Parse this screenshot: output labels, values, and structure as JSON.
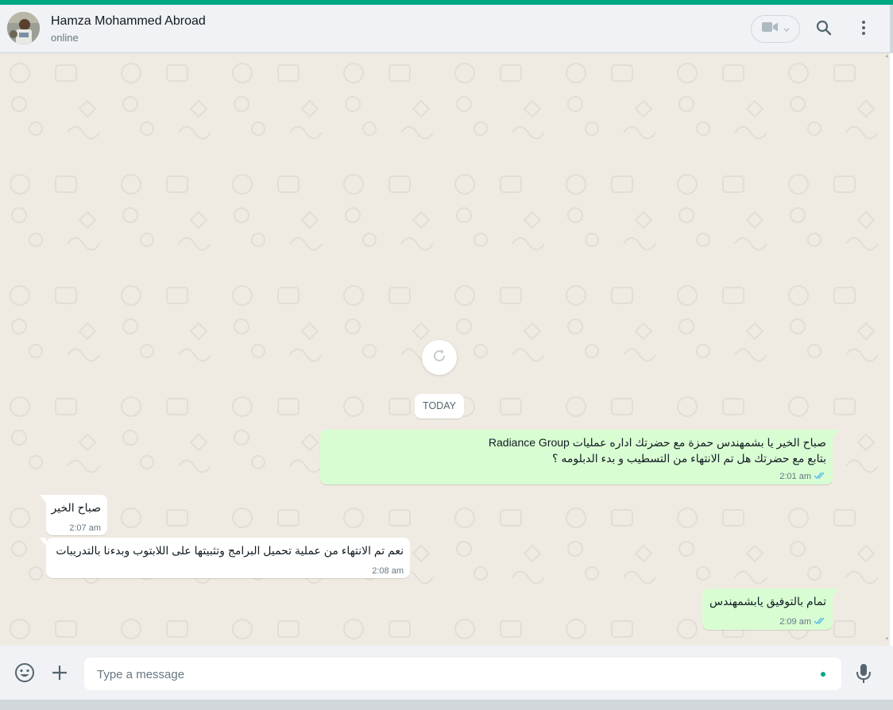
{
  "header": {
    "contact_name": "Hamza Mohammed Abroad",
    "status": "online",
    "avatar_icon": "contact-avatar",
    "video_icon": "video-camera-icon",
    "search_icon": "search-icon",
    "menu_icon": "kebab-menu-icon"
  },
  "chat": {
    "date_chip": "TODAY",
    "refresh_icon": "refresh-icon",
    "messages": [
      {
        "direction": "out",
        "lines": [
          "صباح الخير يا بشمهندس حمزة مع  حضرتك اداره عمليات Radiance Group",
          "بتابع مع حضرتك هل تم الانتهاء من التسطيب و بدء الدبلومه ؟"
        ],
        "time": "2:01 am",
        "status": "read"
      },
      {
        "direction": "in",
        "lines": [
          "صباح الخير"
        ],
        "time": "2:07 am"
      },
      {
        "direction": "in",
        "lines": [
          "نعم تم الانتهاء من عملية تحميل البرامج وتثبيتها على اللابتوب وبدءنا بالتدريبات"
        ],
        "time": "2:08 am"
      },
      {
        "direction": "out",
        "lines": [
          "تمام بالتوفيق يابشمهندس"
        ],
        "time": "2:09 am",
        "status": "read"
      }
    ]
  },
  "compose": {
    "placeholder": "Type a message",
    "value": "",
    "emoji_icon": "emoji-icon",
    "attach_icon": "plus-icon",
    "mic_icon": "microphone-icon"
  },
  "colors": {
    "accent": "#00a884",
    "outgoing_bubble": "#d9fdd3",
    "incoming_bubble": "#ffffff",
    "chat_background": "#efeae2",
    "read_ticks": "#53bdeb"
  }
}
